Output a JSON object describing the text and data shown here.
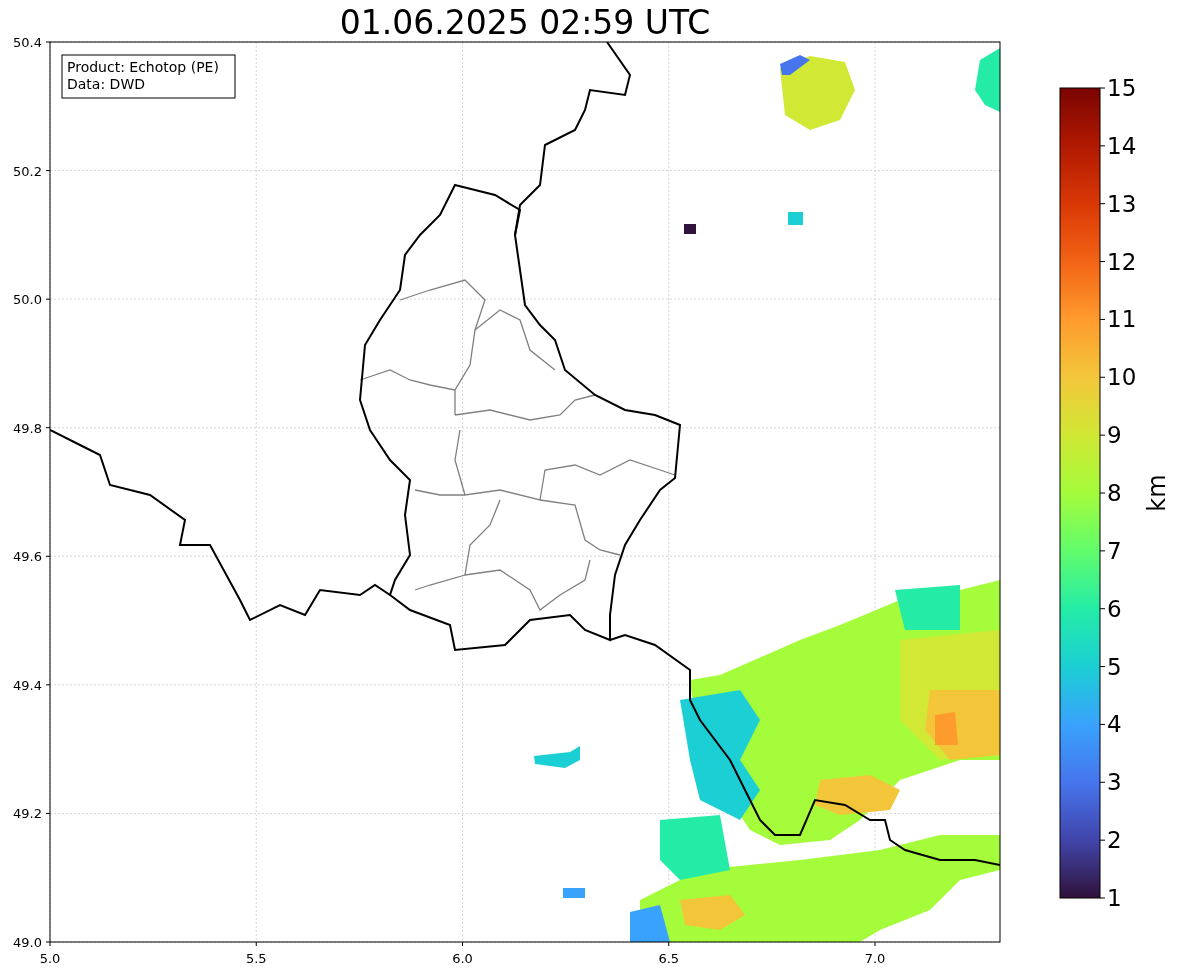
{
  "title": "01.06.2025 02:59 UTC",
  "info_box": [
    "Product: Echotop (PE)",
    "Data: DWD"
  ],
  "x_ticks": [
    "5.0",
    "5.5",
    "6.0",
    "6.5",
    "7.0"
  ],
  "y_ticks": [
    "50.4",
    "50.2",
    "50.0",
    "49.8",
    "49.6",
    "49.4",
    "49.2",
    "49.0"
  ],
  "colorbar": {
    "label": "km",
    "ticks": [
      "15",
      "14",
      "13",
      "12",
      "11",
      "10",
      "9",
      "8",
      "7",
      "6",
      "5",
      "4",
      "3",
      "2",
      "1"
    ]
  }
}
